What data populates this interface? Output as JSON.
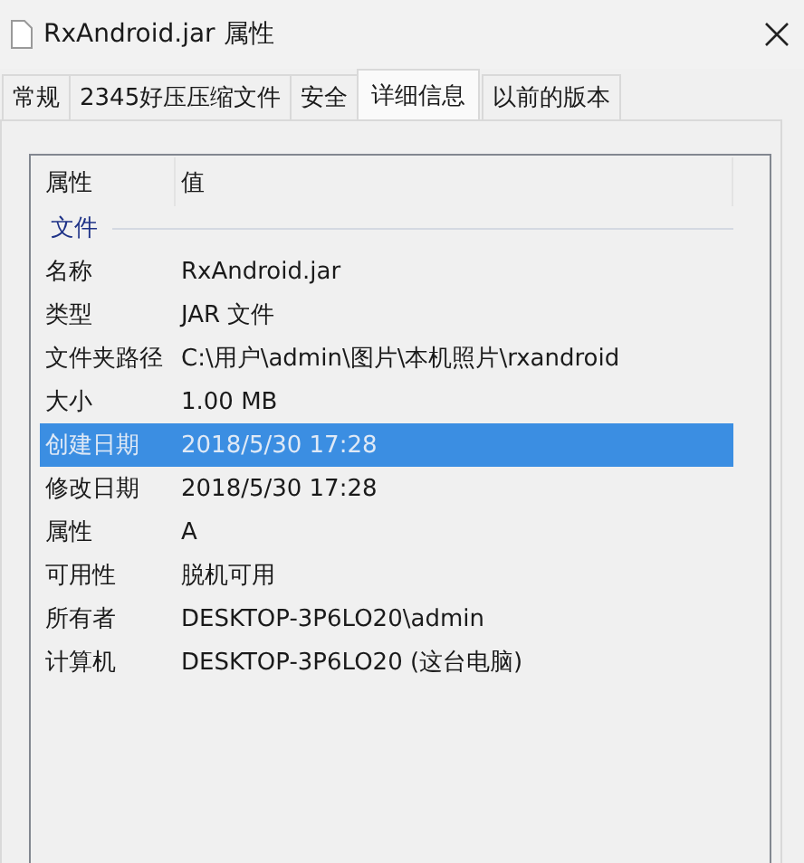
{
  "window": {
    "title": "RxAndroid.jar 属性"
  },
  "tabs": [
    {
      "label": "常规",
      "selected": false
    },
    {
      "label": "2345好压压缩文件",
      "selected": false
    },
    {
      "label": "安全",
      "selected": false
    },
    {
      "label": "详细信息",
      "selected": true
    },
    {
      "label": "以前的版本",
      "selected": false
    }
  ],
  "details": {
    "columns": [
      "属性",
      "值"
    ],
    "group": "文件",
    "rows": [
      {
        "name": "名称",
        "value": "RxAndroid.jar",
        "selected": false
      },
      {
        "name": "类型",
        "value": "JAR 文件",
        "selected": false
      },
      {
        "name": "文件夹路径",
        "value": "C:\\用户\\admin\\图片\\本机照片\\rxandroid",
        "selected": false
      },
      {
        "name": "大小",
        "value": "1.00 MB",
        "selected": false
      },
      {
        "name": "创建日期",
        "value": "2018/5/30 17:28",
        "selected": true
      },
      {
        "name": "修改日期",
        "value": "2018/5/30 17:28",
        "selected": false
      },
      {
        "name": "属性",
        "value": "A",
        "selected": false
      },
      {
        "name": "可用性",
        "value": "脱机可用",
        "selected": false
      },
      {
        "name": "所有者",
        "value": "DESKTOP-3P6LO20\\admin",
        "selected": false
      },
      {
        "name": "计算机",
        "value": "DESKTOP-3P6LO20 (这台电脑)",
        "selected": false
      }
    ]
  }
}
